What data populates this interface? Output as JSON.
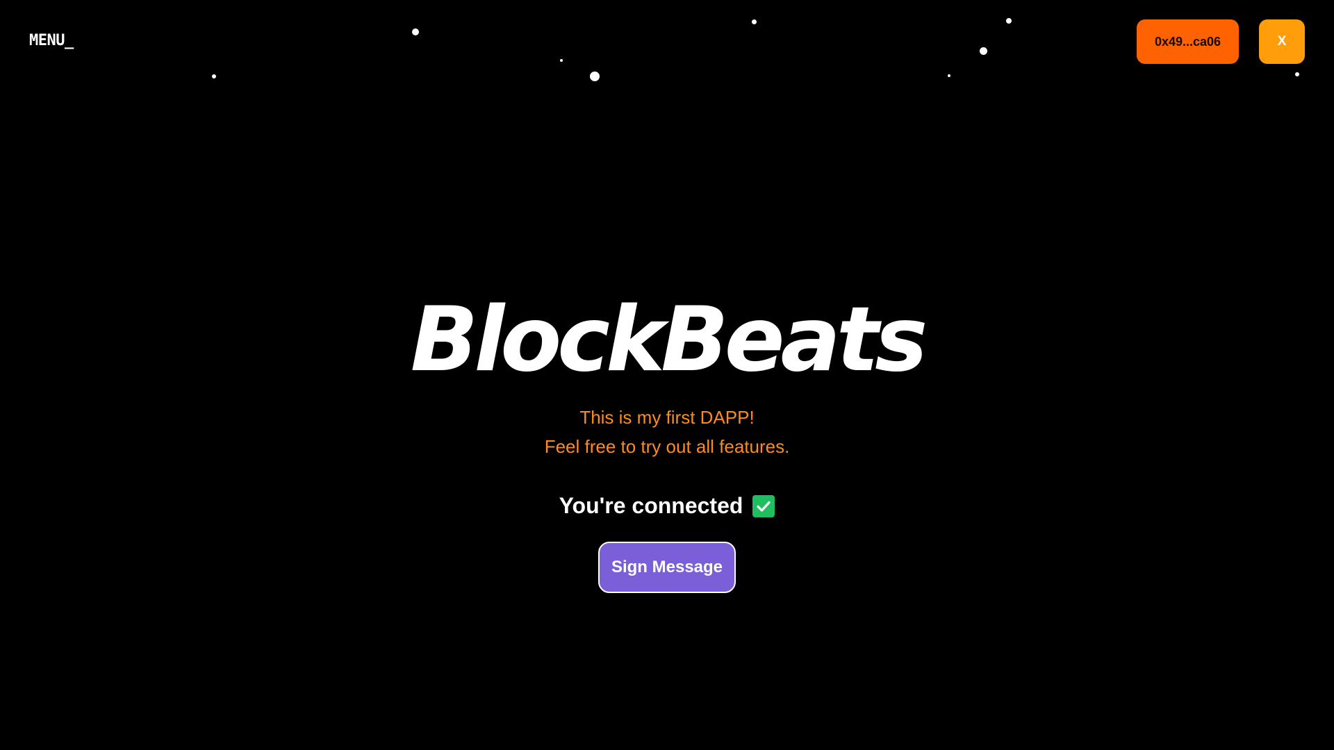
{
  "nav": {
    "menu_label": "MENU_"
  },
  "wallet": {
    "address_label": "0x49...ca06",
    "close_label": "X"
  },
  "hero": {
    "title": "BlockBeats",
    "tagline_line1": "This is my first DAPP!",
    "tagline_line2": "Feel free to try out all features."
  },
  "status": {
    "text": "You're connected",
    "icon": "check-box-icon"
  },
  "actions": {
    "sign_label": "Sign Message"
  },
  "colors": {
    "background": "#000000",
    "wallet_button": "#ff6200",
    "close_button": "#ff9d0a",
    "tagline": "#ff8c1a",
    "check": "#1fbf5f",
    "sign_button": "#7b5fd9"
  }
}
